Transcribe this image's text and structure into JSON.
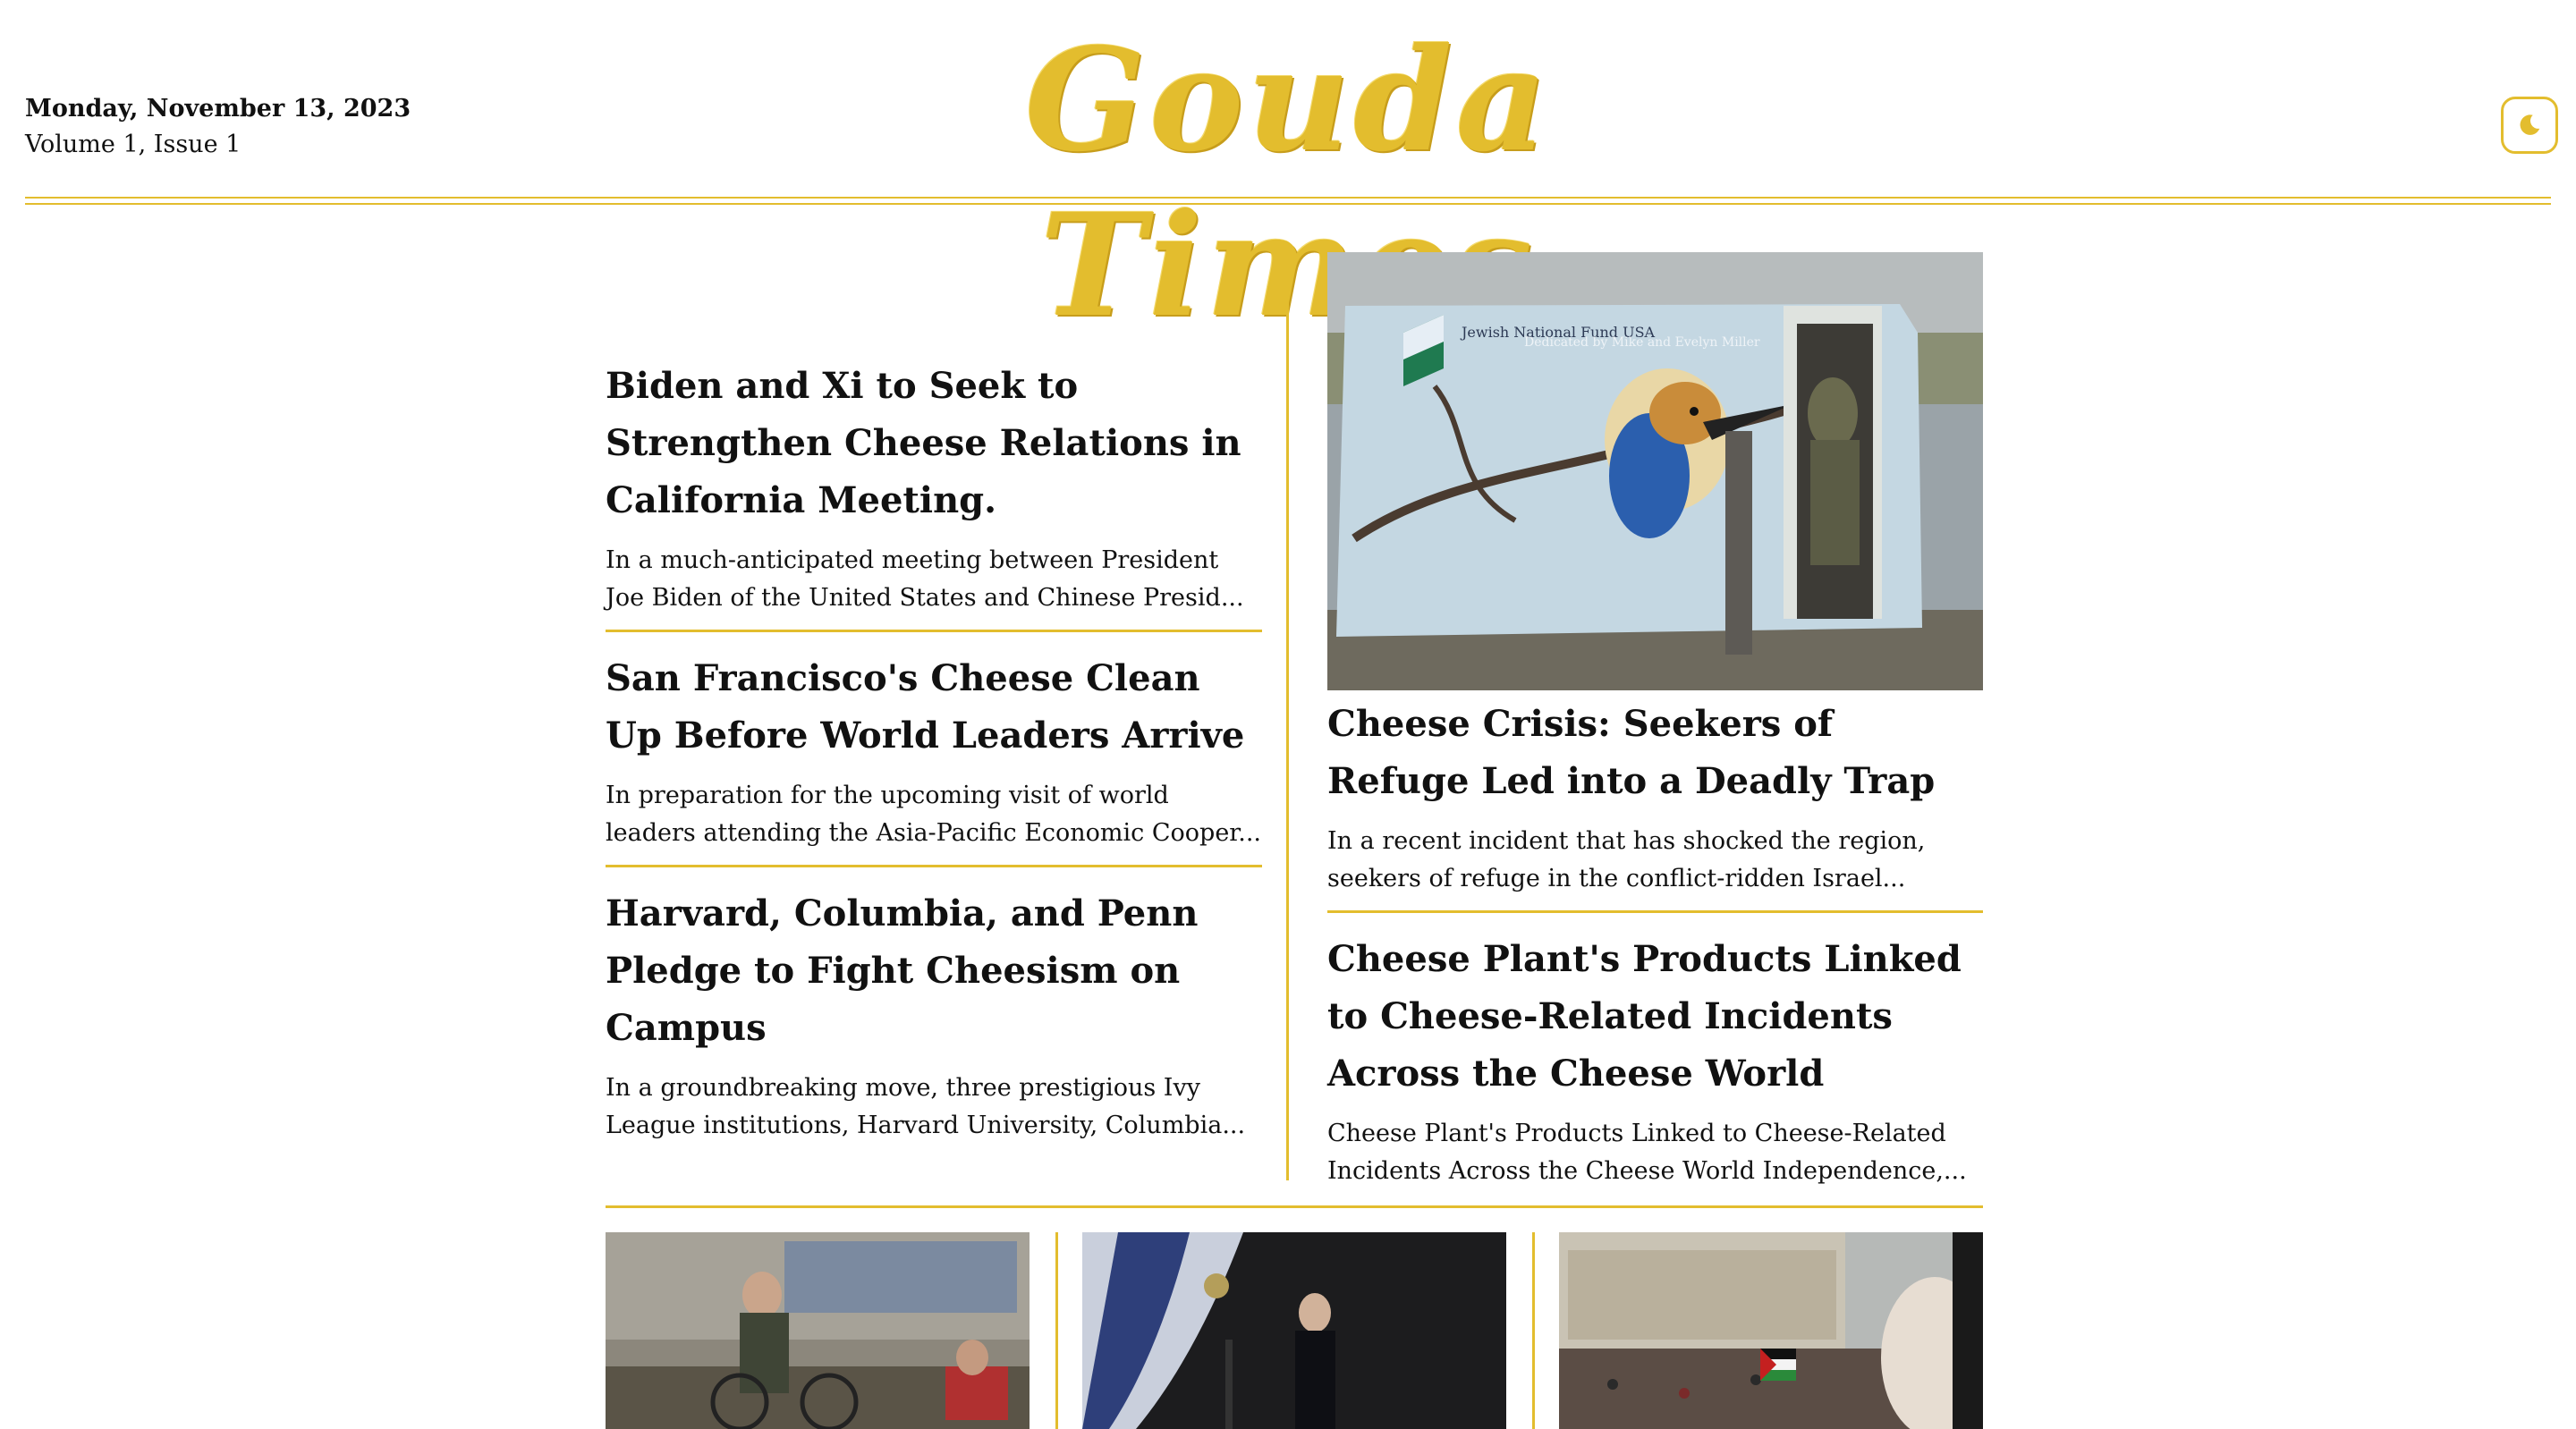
{
  "header": {
    "date": "Monday, November 13, 2023",
    "issue": "Volume 1, Issue 1",
    "masthead": "Gouda Times",
    "theme_toggle_icon": "moon-icon",
    "accent_color": "#e3bd2e"
  },
  "left_stories": [
    {
      "headline": "Biden and Xi to Seek to Strengthen Cheese Relations in California Meeting.",
      "summary": "In a much-anticipated meeting between President Joe Biden of the United States and Chinese Presid..."
    },
    {
      "headline": "San Francisco's Cheese Clean Up Before World Leaders Arrive",
      "summary": "In preparation for the upcoming visit of world leaders attending the Asia-Pacific Economic Cooper..."
    },
    {
      "headline": "Harvard, Columbia, and Penn Pledge to Fight Cheesism on Campus",
      "summary": "In a groundbreaking move, three prestigious Ivy League institutions, Harvard University, Columbia..."
    }
  ],
  "right_stories": [
    {
      "image": "mural-shelter-photo",
      "image_text": "Jewish National Fund USA",
      "image_text_2": "Dedicated by Mike and Evelyn Miller",
      "headline": "Cheese Crisis: Seekers of Refuge Led into a Deadly Trap",
      "summary": "In a recent incident that has shocked the region, seekers of refuge in the conflict-ridden Israel..."
    },
    {
      "headline": "Cheese Plant's Products Linked to Cheese-Related Incidents Across the Cheese World",
      "summary": "Cheese Plant's Products Linked to Cheese-Related Incidents Across the Cheese World Independence,..."
    }
  ],
  "bottom_thumbnails": [
    {
      "image": "street-cyclist-photo"
    },
    {
      "image": "airplane-official-photo"
    },
    {
      "image": "crowd-protest-photo"
    }
  ]
}
